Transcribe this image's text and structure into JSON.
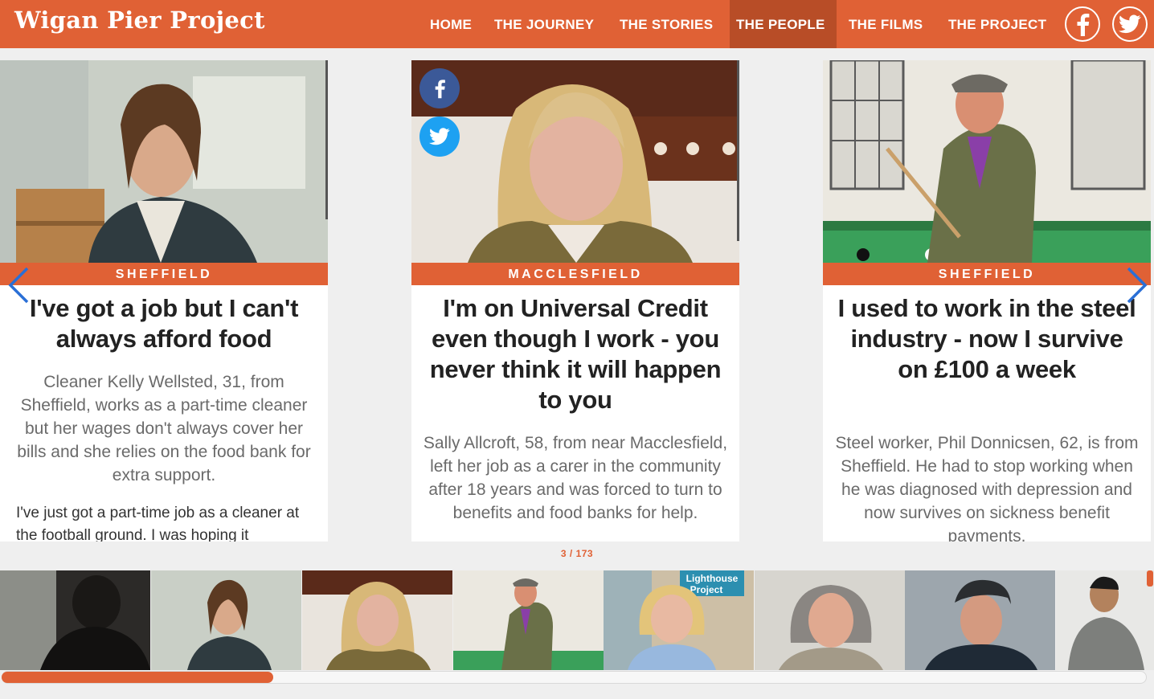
{
  "site": {
    "title": "Wigan Pier Project"
  },
  "nav": {
    "items": [
      {
        "label": "HOME"
      },
      {
        "label": "THE JOURNEY"
      },
      {
        "label": "THE STORIES"
      },
      {
        "label": "THE PEOPLE",
        "active": true
      },
      {
        "label": "THE FILMS"
      },
      {
        "label": "THE PROJECT"
      }
    ],
    "social": [
      "facebook-icon",
      "twitter-icon"
    ]
  },
  "cards": [
    {
      "location": "SHEFFIELD",
      "headline": "I've got a job but I can't always afford food",
      "summary": "Cleaner Kelly Wellsted, 31, from Sheffield, works as a part-time cleaner but her wages don't always cover her bills and she relies on the food bank for extra support.",
      "body": "I've just got a part-time job as a cleaner at the football ground. I was hoping it"
    },
    {
      "location": "MACCLESFIELD",
      "headline": "I'm on Universal Credit even though I work - you never think it will happen to you",
      "summary": "Sally Allcroft, 58, from near Macclesfield, left her job as a carer in the community after 18 years and was forced to turn to benefits and food banks for help."
    },
    {
      "location": "SHEFFIELD",
      "headline": "I used to work in the steel industry - now I survive on £100 a week",
      "summary": "Steel worker, Phil Donnicsen, 62, is from Sheffield. He had to stop working when he was diagnosed with depression and now survives on sickness benefit payments."
    }
  ],
  "counter": "3 / 173",
  "thumbnail_sign": {
    "line1": "Lighthouse",
    "line2": "Project"
  },
  "scrollbar": {
    "progress": 0.24
  },
  "colors": {
    "brand": "#e06135",
    "brand_dark": "#b84d27",
    "facebook": "#3b5998",
    "twitter": "#1da1f2",
    "arrow": "#2a6fd6"
  }
}
